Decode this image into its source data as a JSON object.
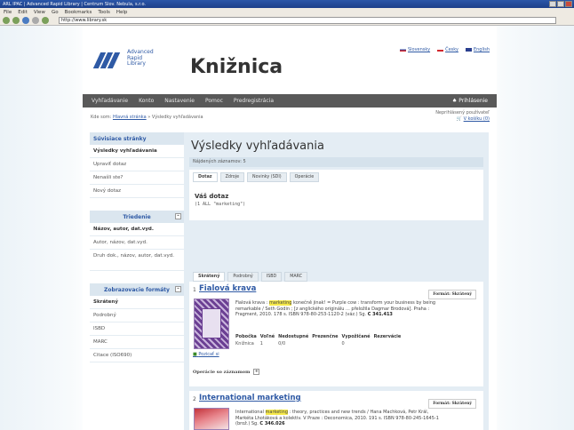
{
  "browser": {
    "title": "ARL IPAC | Advanced Rapid Library | Centrum Slov. Nebula, s.r.o.",
    "menu": [
      "File",
      "Edit",
      "View",
      "Go",
      "Bookmarks",
      "Tools",
      "Help"
    ],
    "url": "http://www.library.sk"
  },
  "header": {
    "logo_line1": "Advanced",
    "logo_line2": "Rapid",
    "logo_line3": "Library",
    "title": "Knižnica",
    "languages": [
      "Slovensky",
      "Česky",
      "English"
    ]
  },
  "topnav": {
    "items": [
      "Vyhľadávanie",
      "Konto",
      "Nastavenie",
      "Pomoc",
      "Predregistrácia"
    ],
    "login": "Prihlásenie"
  },
  "breadcrumb": {
    "prefix": "Kde som:",
    "home": "Hlavná stránka",
    "sep": "»",
    "current": "Výsledky vyhľadávania"
  },
  "user": {
    "status": "Neprihlásený používateľ",
    "basket": "V košíku (0)"
  },
  "sidebar": {
    "related_heading": "Súvisiace stránky",
    "related_items": [
      "Výsledky vyhľadávania",
      "Upraviť dotaz",
      "Nenašli ste?",
      "Nový dotaz"
    ],
    "sort_heading": "Triedenie",
    "sort_items": [
      "Názov, autor, dat.vyd.",
      "Autor, názov, dat.vyd.",
      "Druh dok., názov, autor, dat.vyd."
    ],
    "format_heading": "Zobrazovacie formáty",
    "format_items": [
      "Skrátený",
      "Podrobný",
      "ISBD",
      "MARC",
      "Citace (ISO690)"
    ]
  },
  "main": {
    "heading": "Výsledky vyhľadávania",
    "count": "Nájdených záznamov: 5",
    "query_tabs": [
      "Dotaz",
      "Zdroje",
      "Novinky (SDI)",
      "Operácie"
    ],
    "query_title": "Váš dotaz",
    "query_text": "(1 ALL \"marketing\")",
    "result_tabs": [
      "Skrátený",
      "Podrobný",
      "ISBD",
      "MARC"
    ]
  },
  "results": [
    {
      "num": "1",
      "title": "Fialová krava",
      "short_btn": "Formát: Skrátený",
      "descr_before": "Fialová krava :",
      "descr_hl": "marketing",
      "descr_after": "konečně jinak! = Purple cow : transform your business by being remarkable / Seth Godin ; [z anglického originálu ... přeložila Dagmar Brodová]. Praha : Fragment, 2010. 178 s. ISBN 978-80-253-1120-2 (váz.) Sg. ",
      "signature": "C 341.413",
      "avail_headers": [
        "Pobočka",
        "Voľné",
        "Nedostupné",
        "Prezenčne",
        "Vypožičané",
        "Rezervácie"
      ],
      "avail_row": [
        "Knižnica",
        "1",
        "0/0",
        "",
        "0",
        ""
      ],
      "permalink": "Pozicať si",
      "ops": "Operácie so záznamom"
    },
    {
      "num": "2",
      "title": "International marketing",
      "short_btn": "Formát: Skrátený",
      "descr_before": "International",
      "descr_hl": "marketing",
      "descr_after": ": theory, practices and new trends / Hana Machková, Petr Král, Markéta Lhotáková a kolektiv. V Praze : Oeconomica, 2010. 191 s. ISBN 978-80-245-1645-1 (brož.) Sg. ",
      "signature": "C 346.026"
    }
  ]
}
